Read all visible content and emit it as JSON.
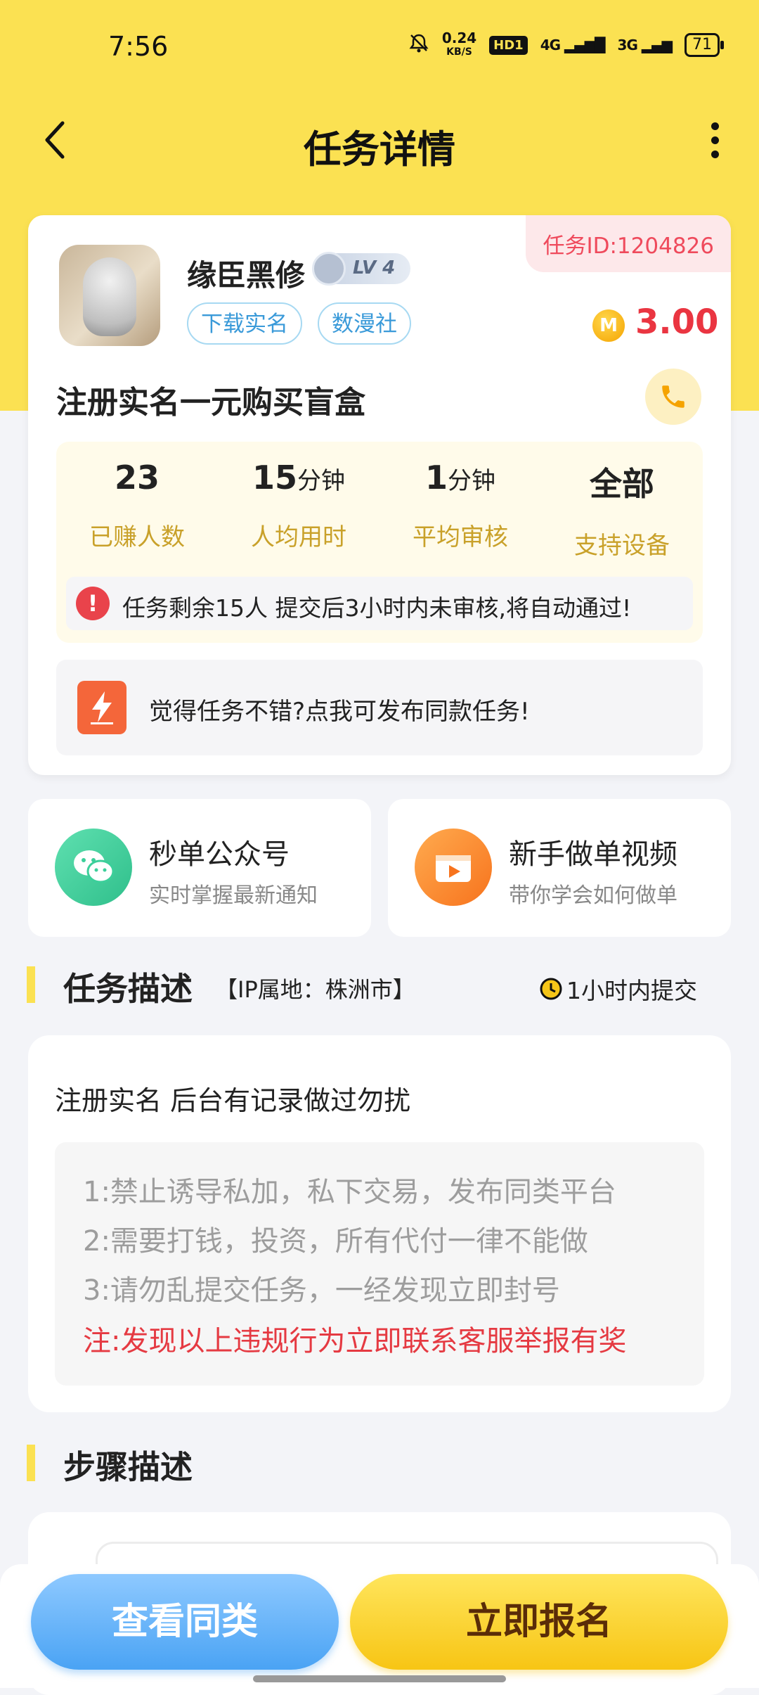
{
  "status_bar": {
    "time": "7:56",
    "net_speed": "0.24",
    "net_speed_unit": "KB/S",
    "hd_label": "HD1",
    "signal1": "4G",
    "signal2": "3G",
    "battery": "71"
  },
  "header": {
    "title": "任务详情"
  },
  "task_card": {
    "task_id": "任务ID:1204826",
    "username": "缘臣黑修",
    "level": "LV 4",
    "tags": [
      "下载实名",
      "数漫社"
    ],
    "coin_symbol": "M",
    "price": "3.00",
    "task_title": "注册实名一元购买盲盒",
    "stats": [
      {
        "value": "23",
        "unit": "",
        "label": "已赚人数"
      },
      {
        "value": "15",
        "unit": "分钟",
        "label": "人均用时"
      },
      {
        "value": "1",
        "unit": "分钟",
        "label": "平均审核"
      },
      {
        "value": "全部",
        "unit": "",
        "label": "支持设备"
      }
    ],
    "notice": "任务剩余15人  提交后3小时内未审核,将自动通过!",
    "publish_text": "觉得任务不错?点我可发布同款任务!"
  },
  "features": [
    {
      "title": "秒单公众号",
      "subtitle": "实时掌握最新通知",
      "icon": "wechat-icon",
      "color": "#3ccf9a"
    },
    {
      "title": "新手做单视频",
      "subtitle": "带你学会如何做单",
      "icon": "video-icon",
      "color": "#fb8a2e"
    }
  ],
  "task_description": {
    "section_title": "任务描述",
    "ip_location": "【IP属地：株洲市】",
    "submit_time": "1小时内提交",
    "intro": "注册实名 后台有记录做过勿扰",
    "rules": [
      "1:禁止诱导私加，私下交易，发布同类平台",
      "2:需要打钱，投资，所有代付一律不能做",
      "3:请勿乱提交任务，一经发现立即封号"
    ],
    "warning": "注:发现以上违规行为立即联系客服举报有奖"
  },
  "steps": {
    "section_title": "步骤描述"
  },
  "bottom_bar": {
    "view_similar": "查看同类",
    "signup": "立即报名"
  },
  "colors": {
    "accent_yellow": "#fbe152",
    "price_red": "#ea3541",
    "link_blue": "#3a9ad9"
  }
}
